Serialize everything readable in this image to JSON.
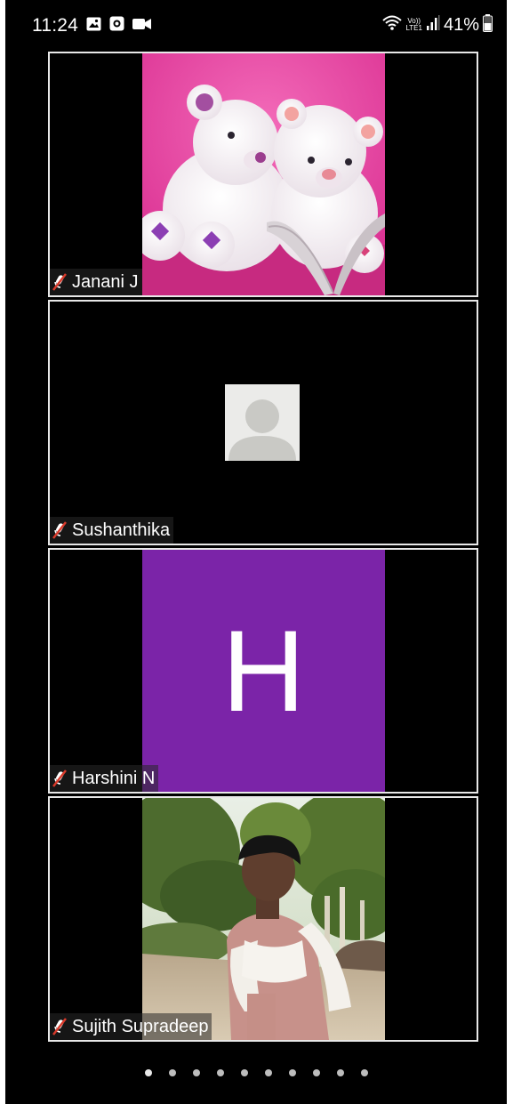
{
  "status_bar": {
    "time": "11:24",
    "battery_percent": "41%",
    "network_label_top": "Vo))",
    "network_label_bottom": "LTE1",
    "icons_left": [
      "gallery-icon",
      "record-icon",
      "video-camera-icon"
    ],
    "icons_right": [
      "wifi-calling-icon",
      "signal-icon",
      "battery-icon"
    ]
  },
  "participants": [
    {
      "name": "Janani J",
      "muted": true,
      "video": "teddy-bear-photo"
    },
    {
      "name": "Sushanthika",
      "muted": true,
      "video": "default-avatar"
    },
    {
      "name": "Harshini N",
      "muted": true,
      "initial": "H",
      "initial_bg": "#7b24a8"
    },
    {
      "name": "Sujith Supradeep",
      "muted": true,
      "video": "outdoor-portrait-photo"
    }
  ],
  "pagination": {
    "total_pages": 10,
    "current_page": 1
  },
  "colors": {
    "background": "#000000",
    "tile_border": "#e8e8e8",
    "teddy_bg": "#e63aa0",
    "avatar_bg": "#ebebe9",
    "avatar_fg": "#c9c9c5",
    "harshini_bg": "#7b24a8",
    "mute_red": "#d93a2b"
  }
}
